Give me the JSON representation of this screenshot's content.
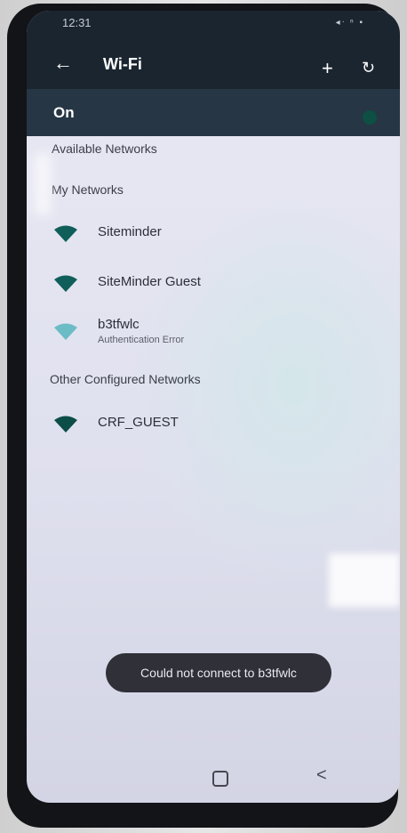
{
  "status_bar": {
    "time": "12:31",
    "icons_text": "◂ᐧ ⁿ ▪"
  },
  "app_bar": {
    "title": "Wi-Fi",
    "back_glyph": "←",
    "add_glyph": "+",
    "refresh_glyph": "↻"
  },
  "wifi_toggle": {
    "label": "On",
    "state": "on"
  },
  "sections": {
    "available": "Available Networks",
    "my_networks": "My Networks",
    "other_configured": "Other Configured Networks"
  },
  "my_networks": [
    {
      "name": "Siteminder",
      "icon": "wifi-icon",
      "status": ""
    },
    {
      "name": "SiteMinder Guest",
      "icon": "wifi-icon",
      "status": ""
    },
    {
      "name": "b3tfwlc",
      "icon": "wifi-icon",
      "status": "Authentication Error"
    }
  ],
  "other_networks": [
    {
      "name": "CRF_GUEST",
      "icon": "wifi-icon",
      "status": ""
    }
  ],
  "toast": {
    "message": "Could not connect to b3tfwlc"
  },
  "nav_bar": {
    "back_glyph": "<",
    "home_icon": "home-icon"
  },
  "colors": {
    "header_bg": "#1b2530",
    "toggle_row_bg": "#263645",
    "wifi_icon_teal": "#0f5e5a",
    "toast_bg": "#2f3038"
  }
}
